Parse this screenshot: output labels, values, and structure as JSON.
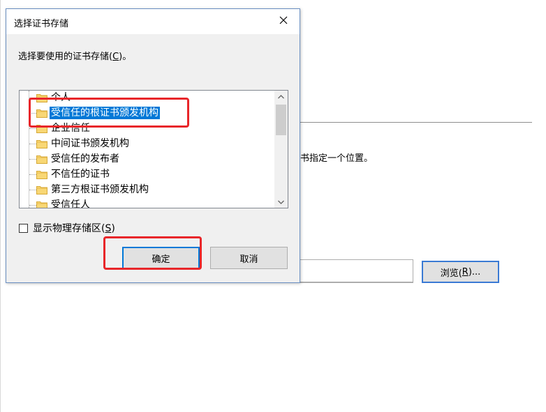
{
  "background_wizard": {
    "instruction_fragment": "书指定一个位置。",
    "browse_button_label": "浏览(R)...",
    "browse_mnemonic_pre": "浏览(",
    "browse_mnemonic_key": "R",
    "browse_mnemonic_post": ")..."
  },
  "dialog": {
    "title": "选择证书存储",
    "close_icon": "close-icon",
    "prompt_pre": "选择要使用的证书存储(",
    "prompt_key": "C",
    "prompt_post": ")。",
    "store_tree": {
      "items": [
        {
          "label": "个人",
          "selected": false
        },
        {
          "label": "受信任的根证书颁发机构",
          "selected": true
        },
        {
          "label": "企业信任",
          "selected": false
        },
        {
          "label": "中间证书颁发机构",
          "selected": false
        },
        {
          "label": "受信任的发布者",
          "selected": false
        },
        {
          "label": "不信任的证书",
          "selected": false
        },
        {
          "label": "第三方根证书颁发机构",
          "selected": false
        },
        {
          "label": "受信任人",
          "selected": false
        }
      ]
    },
    "show_physical_pre": "显示物理存储区(",
    "show_physical_key": "S",
    "show_physical_post": ")",
    "show_physical_checked": false,
    "ok_label": "确定",
    "cancel_label": "取消"
  },
  "colors": {
    "selection": "#0078d7",
    "annotation": "#e8262a",
    "dialog_border": "#6a8fc2"
  }
}
